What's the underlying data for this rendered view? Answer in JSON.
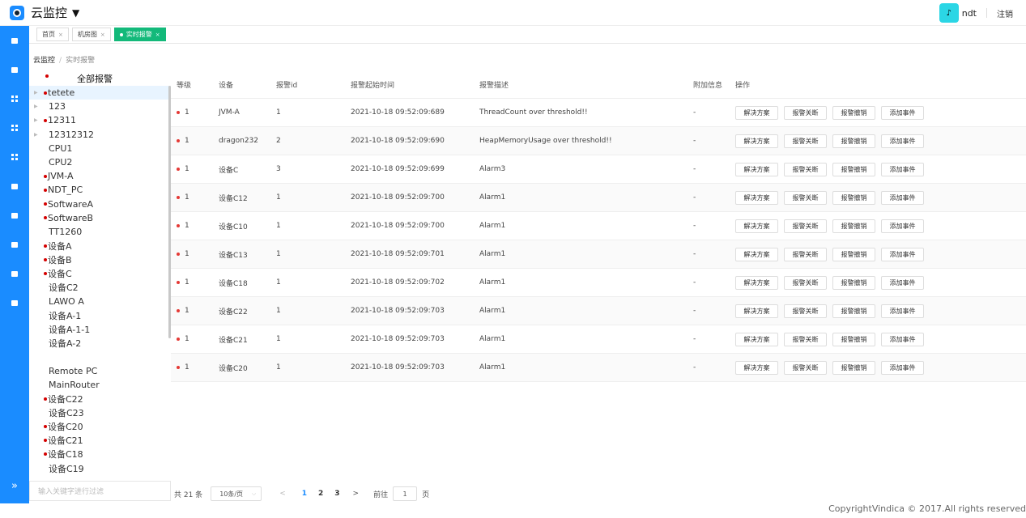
{
  "header": {
    "app_title": "云监控",
    "caret": "▼",
    "username": "ndt",
    "logout": "注销"
  },
  "leftbar": {
    "expand": "»"
  },
  "tabs": [
    {
      "label": "首页"
    },
    {
      "label": "机房图"
    },
    {
      "label": "实时报警",
      "active": true
    }
  ],
  "breadcrumb": {
    "root": "云监控",
    "current": "实时报警"
  },
  "tree": {
    "header": "全部报警",
    "items": [
      {
        "label": "tetete",
        "arrow": true,
        "alarm": true,
        "selected": true
      },
      {
        "label": "123",
        "arrow": true,
        "alarm": false
      },
      {
        "label": "12311",
        "arrow": true,
        "alarm": true
      },
      {
        "label": "12312312",
        "arrow": true,
        "alarm": false
      },
      {
        "label": "CPU1",
        "alarm": false
      },
      {
        "label": "CPU2",
        "alarm": false
      },
      {
        "label": "JVM-A",
        "alarm": true
      },
      {
        "label": "NDT_PC",
        "alarm": true
      },
      {
        "label": "SoftwareA",
        "alarm": true
      },
      {
        "label": "SoftwareB",
        "alarm": true
      },
      {
        "label": "TT1260",
        "alarm": false
      },
      {
        "label": "设备A",
        "alarm": true
      },
      {
        "label": "设备B",
        "alarm": true
      },
      {
        "label": "设备C",
        "alarm": true
      },
      {
        "label": "设备C2",
        "alarm": false
      },
      {
        "label": "LAWO A",
        "alarm": false
      },
      {
        "label": "设备A-1",
        "alarm": false
      },
      {
        "label": "设备A-1-1",
        "alarm": false
      },
      {
        "label": "设备A-2",
        "alarm": false
      },
      {
        "label": "",
        "alarm": false
      },
      {
        "label": "Remote PC",
        "alarm": false
      },
      {
        "label": "MainRouter",
        "alarm": false
      },
      {
        "label": "设备C22",
        "alarm": true
      },
      {
        "label": "设备C23",
        "alarm": false
      },
      {
        "label": "设备C20",
        "alarm": true
      },
      {
        "label": "设备C21",
        "alarm": true
      },
      {
        "label": "设备C18",
        "alarm": true
      },
      {
        "label": "设备C19",
        "alarm": false
      }
    ],
    "filter_placeholder": "输入关键字进行过滤"
  },
  "table": {
    "columns": [
      "等级",
      "设备",
      "报警id",
      "报警起始时间",
      "报警描述",
      "附加信息",
      "操作"
    ],
    "actions": [
      "解决方案",
      "报警关断",
      "报警撤销",
      "添加事件"
    ],
    "rows": [
      {
        "level": "1",
        "device": "JVM-A",
        "id": "1",
        "time": "2021-10-18 09:52:09:689",
        "desc": "ThreadCount over threshold!!",
        "extra": "-"
      },
      {
        "level": "1",
        "device": "dragon232",
        "id": "2",
        "time": "2021-10-18 09:52:09:690",
        "desc": "HeapMemoryUsage over threshold!!",
        "extra": "-"
      },
      {
        "level": "1",
        "device": "设备C",
        "id": "3",
        "time": "2021-10-18 09:52:09:699",
        "desc": "Alarm3",
        "extra": "-"
      },
      {
        "level": "1",
        "device": "设备C12",
        "id": "1",
        "time": "2021-10-18 09:52:09:700",
        "desc": "Alarm1",
        "extra": "-"
      },
      {
        "level": "1",
        "device": "设备C10",
        "id": "1",
        "time": "2021-10-18 09:52:09:700",
        "desc": "Alarm1",
        "extra": "-"
      },
      {
        "level": "1",
        "device": "设备C13",
        "id": "1",
        "time": "2021-10-18 09:52:09:701",
        "desc": "Alarm1",
        "extra": "-"
      },
      {
        "level": "1",
        "device": "设备C18",
        "id": "1",
        "time": "2021-10-18 09:52:09:702",
        "desc": "Alarm1",
        "extra": "-"
      },
      {
        "level": "1",
        "device": "设备C22",
        "id": "1",
        "time": "2021-10-18 09:52:09:703",
        "desc": "Alarm1",
        "extra": "-"
      },
      {
        "level": "1",
        "device": "设备C21",
        "id": "1",
        "time": "2021-10-18 09:52:09:703",
        "desc": "Alarm1",
        "extra": "-"
      },
      {
        "level": "1",
        "device": "设备C20",
        "id": "1",
        "time": "2021-10-18 09:52:09:703",
        "desc": "Alarm1",
        "extra": "-"
      }
    ]
  },
  "pager": {
    "total": "共 21 条",
    "page_size": "10条/页",
    "prev": "<",
    "pages": [
      "1",
      "2",
      "3"
    ],
    "next": ">",
    "goto_label": "前往",
    "goto_value": "1",
    "page_suffix": "页"
  },
  "footer": {
    "copyright": "CopyrightVindica © 2017.All rights reserved"
  },
  "colors": {
    "accent": "#1a8cff",
    "active_tab": "#13b97a",
    "alarm": "#d40000"
  }
}
